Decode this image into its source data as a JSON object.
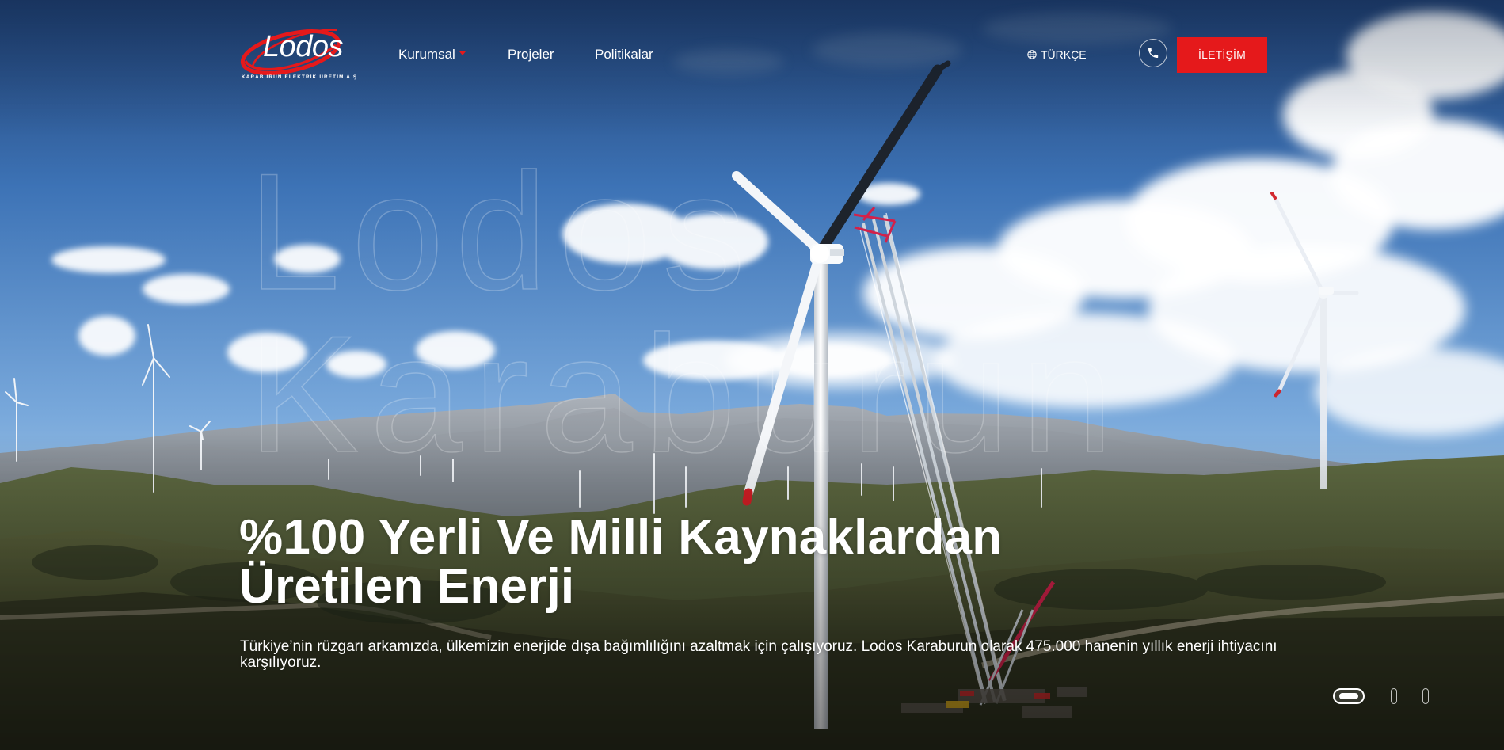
{
  "brand": {
    "logo_text": "Lodos",
    "logo_subtitle": "KARABURUN ELEKTRİK ÜRETİM A.Ş.",
    "accent_color": "#e5191b",
    "text_color": "#ffffff"
  },
  "nav": {
    "items": [
      {
        "label": "Kurumsal",
        "has_dropdown": true
      },
      {
        "label": "Projeler",
        "has_dropdown": false
      },
      {
        "label": "Politikalar",
        "has_dropdown": false
      }
    ]
  },
  "header": {
    "language_label": "TÜRKÇE",
    "language_icon": "globe-icon",
    "phone_icon": "phone-icon",
    "contact_label": "İLETİŞİM"
  },
  "hero": {
    "watermark_line1": "Lodos",
    "watermark_line2": "Karaburun",
    "title": "%100 Yerli Ve Milli Kaynaklardan\nÜretilen Enerji",
    "description": "Türkiye’nin rüzgarı arkamızda, ülkemizin enerjide dışa bağımlılığını azaltmak için çalışıyoruz. Lodos Karaburun olarak 475.000 hanenin yıllık enerji ihtiyacını karşılıyoruz.",
    "background_subject": "wind turbines on a hillside in front of a mountain range"
  },
  "slider": {
    "total": 3,
    "active": 1
  }
}
